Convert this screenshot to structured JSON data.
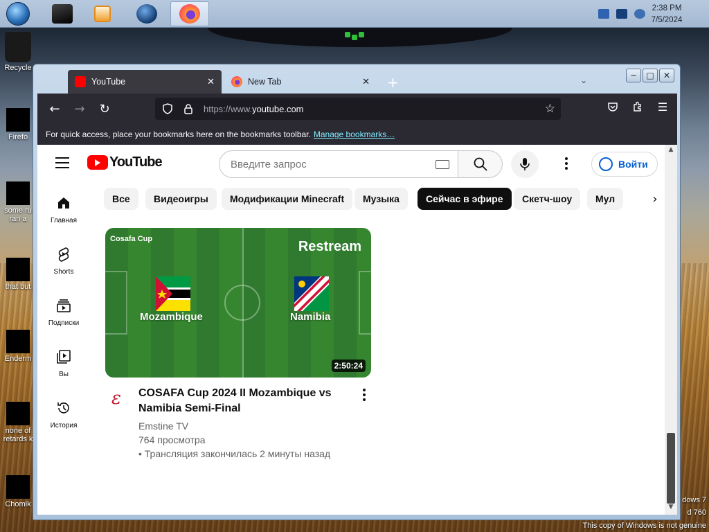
{
  "taskbar": {
    "clock_time": "2:38 PM",
    "clock_date": "7/5/2024",
    "apps": [
      "start-orb",
      "media-icon",
      "player-icon",
      "globe-icon",
      "firefox-icon"
    ]
  },
  "desktop": {
    "icons": [
      {
        "label": "Recycle",
        "icon": "recycle-bin-icon"
      },
      {
        "label": "Firefo",
        "icon": "firefox-desktop-icon"
      },
      {
        "label": "some ru",
        "label2": "ran a",
        "icon": "folder-icon"
      },
      {
        "label": "that but",
        "icon": "file-icon"
      },
      {
        "label": "Enderm",
        "icon": "file-icon"
      },
      {
        "label": "none of",
        "label2": "retards k",
        "icon": "file-icon"
      },
      {
        "label": "Chomik",
        "icon": "file-icon"
      }
    ],
    "watermark_line1": "dows 7",
    "watermark_line2": "d 760",
    "watermark_line3": "This copy of Windows is not genuine"
  },
  "browser": {
    "tabs": [
      {
        "label": "YouTube",
        "active": true
      },
      {
        "label": "New Tab",
        "active": false
      }
    ],
    "url_prefix": "https://www.",
    "url_domain": "youtube.com",
    "bookmarks_text": "For quick access, place your bookmarks here on the bookmarks toolbar.",
    "bookmarks_link": "Manage bookmarks…"
  },
  "youtube": {
    "logo_text": "YouTube",
    "search_placeholder": "Введите запрос",
    "signin_label": "Войти",
    "sidebar": [
      {
        "label": "Главная",
        "icon": "home-icon"
      },
      {
        "label": "Shorts",
        "icon": "shorts-icon"
      },
      {
        "label": "Подписки",
        "icon": "subscriptions-icon"
      },
      {
        "label": "Вы",
        "icon": "you-icon"
      },
      {
        "label": "История",
        "icon": "history-icon"
      }
    ],
    "chips": [
      "Все",
      "Видеоигры",
      "Модификации Minecraft",
      "Музыка",
      "Сейчас в эфире",
      "Скетч-шоу",
      "Мул"
    ],
    "selected_chip": "Сейчас в эфире",
    "video": {
      "thumb_caption": "Cosafa Cup",
      "thumb_badge": "Restream",
      "team1": "Mozambique",
      "team2": "Namibia",
      "duration": "2:50:24",
      "title": "COSAFA Cup 2024 II Mozambique vs Namibia Semi-Final",
      "channel": "Emstine TV",
      "views": "764 просмотра",
      "status": "• Трансляция закончилась 2 минуты назад"
    }
  },
  "colors": {
    "yt_red": "#ff0000",
    "chip_selected": "#0f0f0f",
    "link_blue": "#065fd4",
    "firefox_toolbar": "#2b2a33"
  }
}
